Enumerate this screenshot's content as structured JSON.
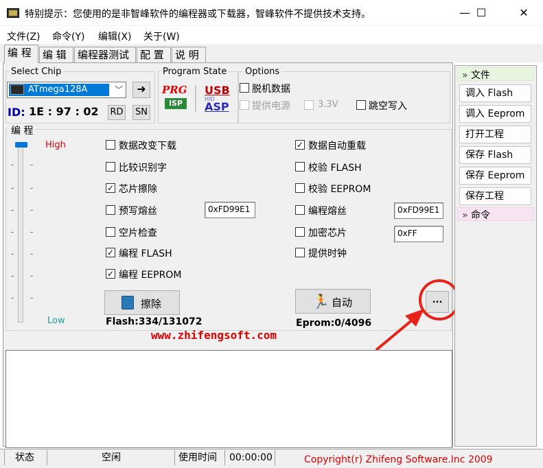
{
  "window": {
    "title": "特别提示：您使用的是非智峰软件的编程器或下载器，智峰软件不提供技术支持。",
    "minimize": "—",
    "maximize": "☐",
    "close": "✕"
  },
  "menu": [
    "文件(Z)",
    "命令(Y)",
    "编辑(X)",
    "关于(W)"
  ],
  "tabs": [
    "编 程",
    "编 辑",
    "编程器测试",
    "配 置",
    "说 明"
  ],
  "select_chip": {
    "title": "Select Chip",
    "value": "ATmega128A",
    "id_label": "ID:",
    "id_value": "1E : 97 : 02",
    "rd": "RD",
    "sn": "SN",
    "go": "➜"
  },
  "program_state": {
    "title": "Program State",
    "prg": "PRG",
    "isp": "ISP",
    "usb": "USB",
    "hid": "HID",
    "asp": "ASP"
  },
  "options": {
    "title": "Options",
    "offline_data": "脱机数据",
    "power": "提供电源",
    "v33": "3.3V",
    "skip_empty": "跳空写入"
  },
  "program": {
    "title": "编 程",
    "high": "High",
    "low": "Low",
    "left_options": [
      {
        "label": "数据改变下载",
        "checked": false
      },
      {
        "label": "比较识别字",
        "checked": false
      },
      {
        "label": "芯片擦除",
        "checked": true
      },
      {
        "label": "预写熔丝",
        "checked": false
      },
      {
        "label": "空片检查",
        "checked": false
      },
      {
        "label": "编程 FLASH",
        "checked": true
      },
      {
        "label": "编程 EEPROM",
        "checked": true
      }
    ],
    "right_options": [
      {
        "label": "数据自动重载",
        "checked": true
      },
      {
        "label": "校验 FLASH",
        "checked": false
      },
      {
        "label": "校验 EEPROM",
        "checked": false
      },
      {
        "label": "编程熔丝",
        "checked": false
      },
      {
        "label": "加密芯片",
        "checked": false
      },
      {
        "label": "提供时钟",
        "checked": false
      }
    ],
    "prewrite_fuse_value": "0xFD99E1",
    "fuse_value": "0xFD99E1",
    "lock_value": "0xFF",
    "erase_button": "擦除",
    "auto_button": "自动",
    "more_button": "...",
    "flash_info": "Flash:334/131072",
    "eprom_info": "Eprom:0/4096",
    "website": "www.zhifengsoft.com"
  },
  "side": {
    "file_header": "文件",
    "file_items": [
      "调入 Flash",
      "调入 Eeprom",
      "打开工程",
      "保存 Flash",
      "保存 Eeprom",
      "保存工程"
    ],
    "command_header": "命令"
  },
  "status": {
    "state_label": "状态",
    "state_value": "空闲",
    "time_label": "使用时间",
    "time_value": "00:00:00",
    "copyright": "Copyright(r) Zhifeng Software.Inc 2009"
  },
  "colors": {
    "accent": "#0078d7",
    "high": "#e00000",
    "low": "#1a9e9e",
    "website": "#e00000",
    "prg": "#e00000",
    "usb": "#c00000",
    "asp": "#2a2ab8",
    "isp": "#1a8a3a",
    "annotation": "#e8231a"
  }
}
